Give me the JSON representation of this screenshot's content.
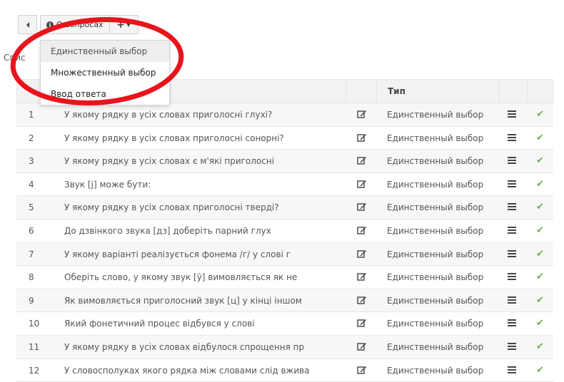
{
  "toolbar": {
    "back_icon": "caret-left-icon",
    "about_label": "О вопросах",
    "info_icon": "info-circle-icon",
    "add_icon": "plus-icon"
  },
  "list_label": "Спис",
  "dropdown": {
    "items": [
      {
        "label": "Единственный выбор",
        "active": true
      },
      {
        "label": "Множественный выбор",
        "active": false
      },
      {
        "label": "Ввод ответа",
        "active": false
      }
    ]
  },
  "table": {
    "type_header": "Тип",
    "rows": [
      {
        "num": "1",
        "question": "У якому рядку в усіх словах приголосні глухі?",
        "type": "Единственный выбор"
      },
      {
        "num": "2",
        "question": "У якому рядку в усіх словах приголосні сонорні?",
        "type": "Единственный выбор"
      },
      {
        "num": "3",
        "question": "У якому рядку в усіх словах є м'які приголосні",
        "type": "Единственный выбор"
      },
      {
        "num": "4",
        "question": "Звук [j] може бути:",
        "type": "Единственный выбор"
      },
      {
        "num": "5",
        "question": "У якому рядку в усіх словах приголосні тверді?",
        "type": "Единственный выбор"
      },
      {
        "num": "6",
        "question": "До дзвінкого звука [дз]  доберіть парний глух",
        "type": "Единственный выбор"
      },
      {
        "num": "7",
        "question": "У якому варіанті реалізується фонема /г/ у слові г",
        "type": "Единственный выбор"
      },
      {
        "num": "8",
        "question": "Оберіть слово, у якому звук [ў] вимовляється як не",
        "type": "Единственный выбор"
      },
      {
        "num": "9",
        "question": "Як вимовляється приголосний звук [ц] у кінці іншом",
        "type": "Единственный выбор"
      },
      {
        "num": "10",
        "question": "Який  фонетичний процес відбувся у слові",
        "type": "Единственный выбор"
      },
      {
        "num": "11",
        "question": "У якому рядку в усіх словах відбулося спрощення пр",
        "type": "Единственный выбор"
      },
      {
        "num": "12",
        "question": "У словосполуках якого рядка між словами слід вжива",
        "type": "Единственный выбор"
      }
    ]
  },
  "colors": {
    "annotation": "#e8141c",
    "check": "#6ab04c"
  }
}
